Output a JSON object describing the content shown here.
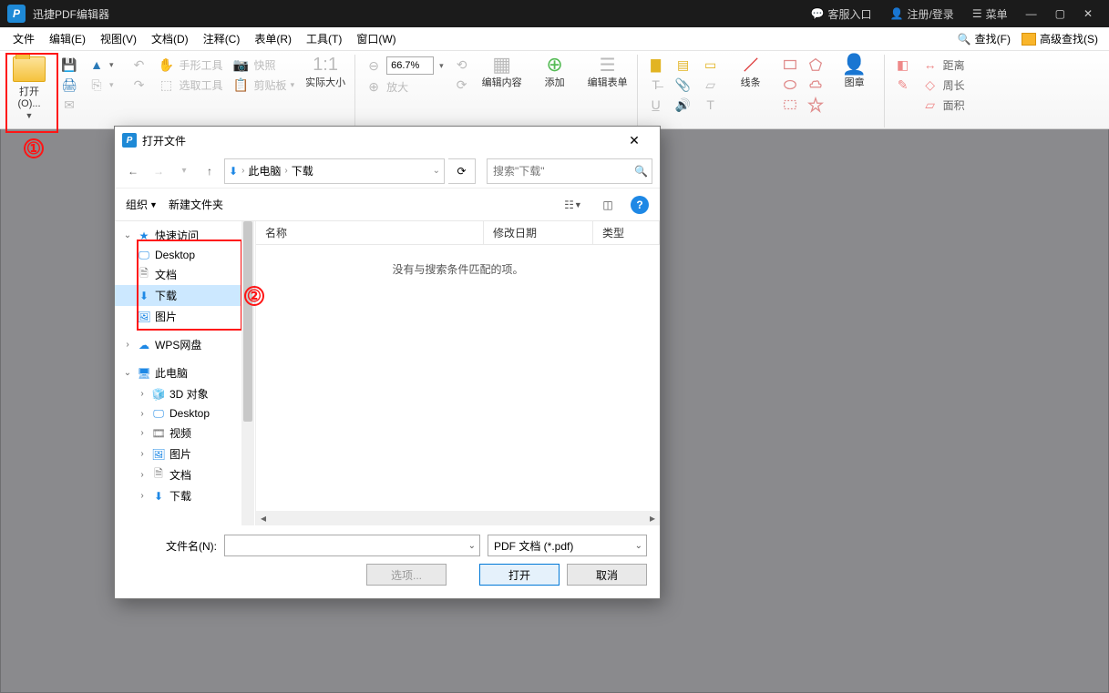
{
  "app": {
    "title": "迅捷PDF编辑器"
  },
  "titlebar": {
    "service": "客服入口",
    "login": "注册/登录",
    "menu": "菜单"
  },
  "menubar": {
    "items": [
      "文件",
      "编辑(E)",
      "视图(V)",
      "文档(D)",
      "注释(C)",
      "表单(R)",
      "工具(T)",
      "窗口(W)"
    ],
    "find": "查找(F)",
    "advfind": "高级查找(S)"
  },
  "ribbon": {
    "open": "打开(O)...",
    "hand": "手形工具",
    "select": "选取工具",
    "snapshot": "快照",
    "clipboard": "剪贴板",
    "actual": "实际大小",
    "zoom": "66.7%",
    "zoomin": "放大",
    "editcontent": "编辑内容",
    "add": "添加",
    "editform": "编辑表单",
    "lines": "线条",
    "stamp": "图章",
    "distance": "距离",
    "perimeter": "周长",
    "area": "面积"
  },
  "dialog": {
    "title": "打开文件",
    "path": {
      "root": "此电脑",
      "folder": "下载"
    },
    "search_placeholder": "搜索\"下载\"",
    "toolbar": {
      "organize": "组织",
      "newfolder": "新建文件夹"
    },
    "columns": {
      "name": "名称",
      "date": "修改日期",
      "type": "类型"
    },
    "empty": "没有与搜索条件匹配的项。",
    "tree": {
      "quick": "快速访问",
      "quick_items": [
        "Desktop",
        "文档",
        "下载",
        "图片"
      ],
      "wps": "WPS网盘",
      "thispc": "此电脑",
      "pc_items": [
        "3D 对象",
        "Desktop",
        "视频",
        "图片",
        "文档",
        "下载"
      ]
    },
    "footer": {
      "filename_label": "文件名(N):",
      "filter": "PDF 文档 (*.pdf)",
      "options": "选项...",
      "open": "打开",
      "cancel": "取消"
    }
  },
  "annotations": {
    "one": "①",
    "two": "②"
  }
}
